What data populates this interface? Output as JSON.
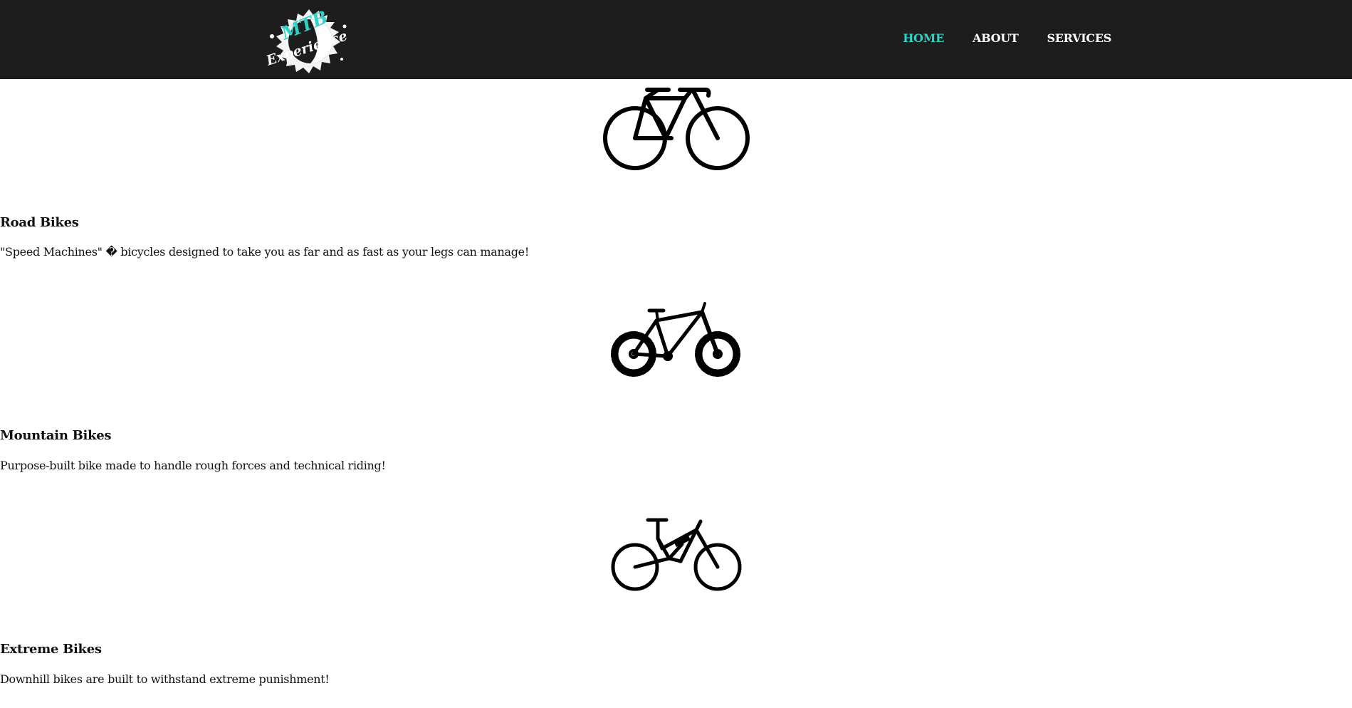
{
  "header": {
    "logo": {
      "line1": "MTB",
      "line2": "Experience",
      "accent_color": "#2fd3c6"
    },
    "nav": [
      {
        "label": "HOME",
        "active": true
      },
      {
        "label": "ABOUT",
        "active": false
      },
      {
        "label": "SERVICES",
        "active": false
      }
    ],
    "background": "#1d1d1d"
  },
  "bikes": [
    {
      "icon": "road-bike-icon",
      "title": "Road Bikes",
      "description": "\"Speed Machines\" � bicycles designed to take you as far and as fast as your legs can manage!"
    },
    {
      "icon": "mountain-bike-icon",
      "title": "Mountain Bikes",
      "description": "Purpose-built bike made to handle rough forces and technical riding!"
    },
    {
      "icon": "downhill-bike-icon",
      "title": "Extreme Bikes",
      "description": "Downhill bikes are built to withstand extreme punishment!"
    }
  ]
}
